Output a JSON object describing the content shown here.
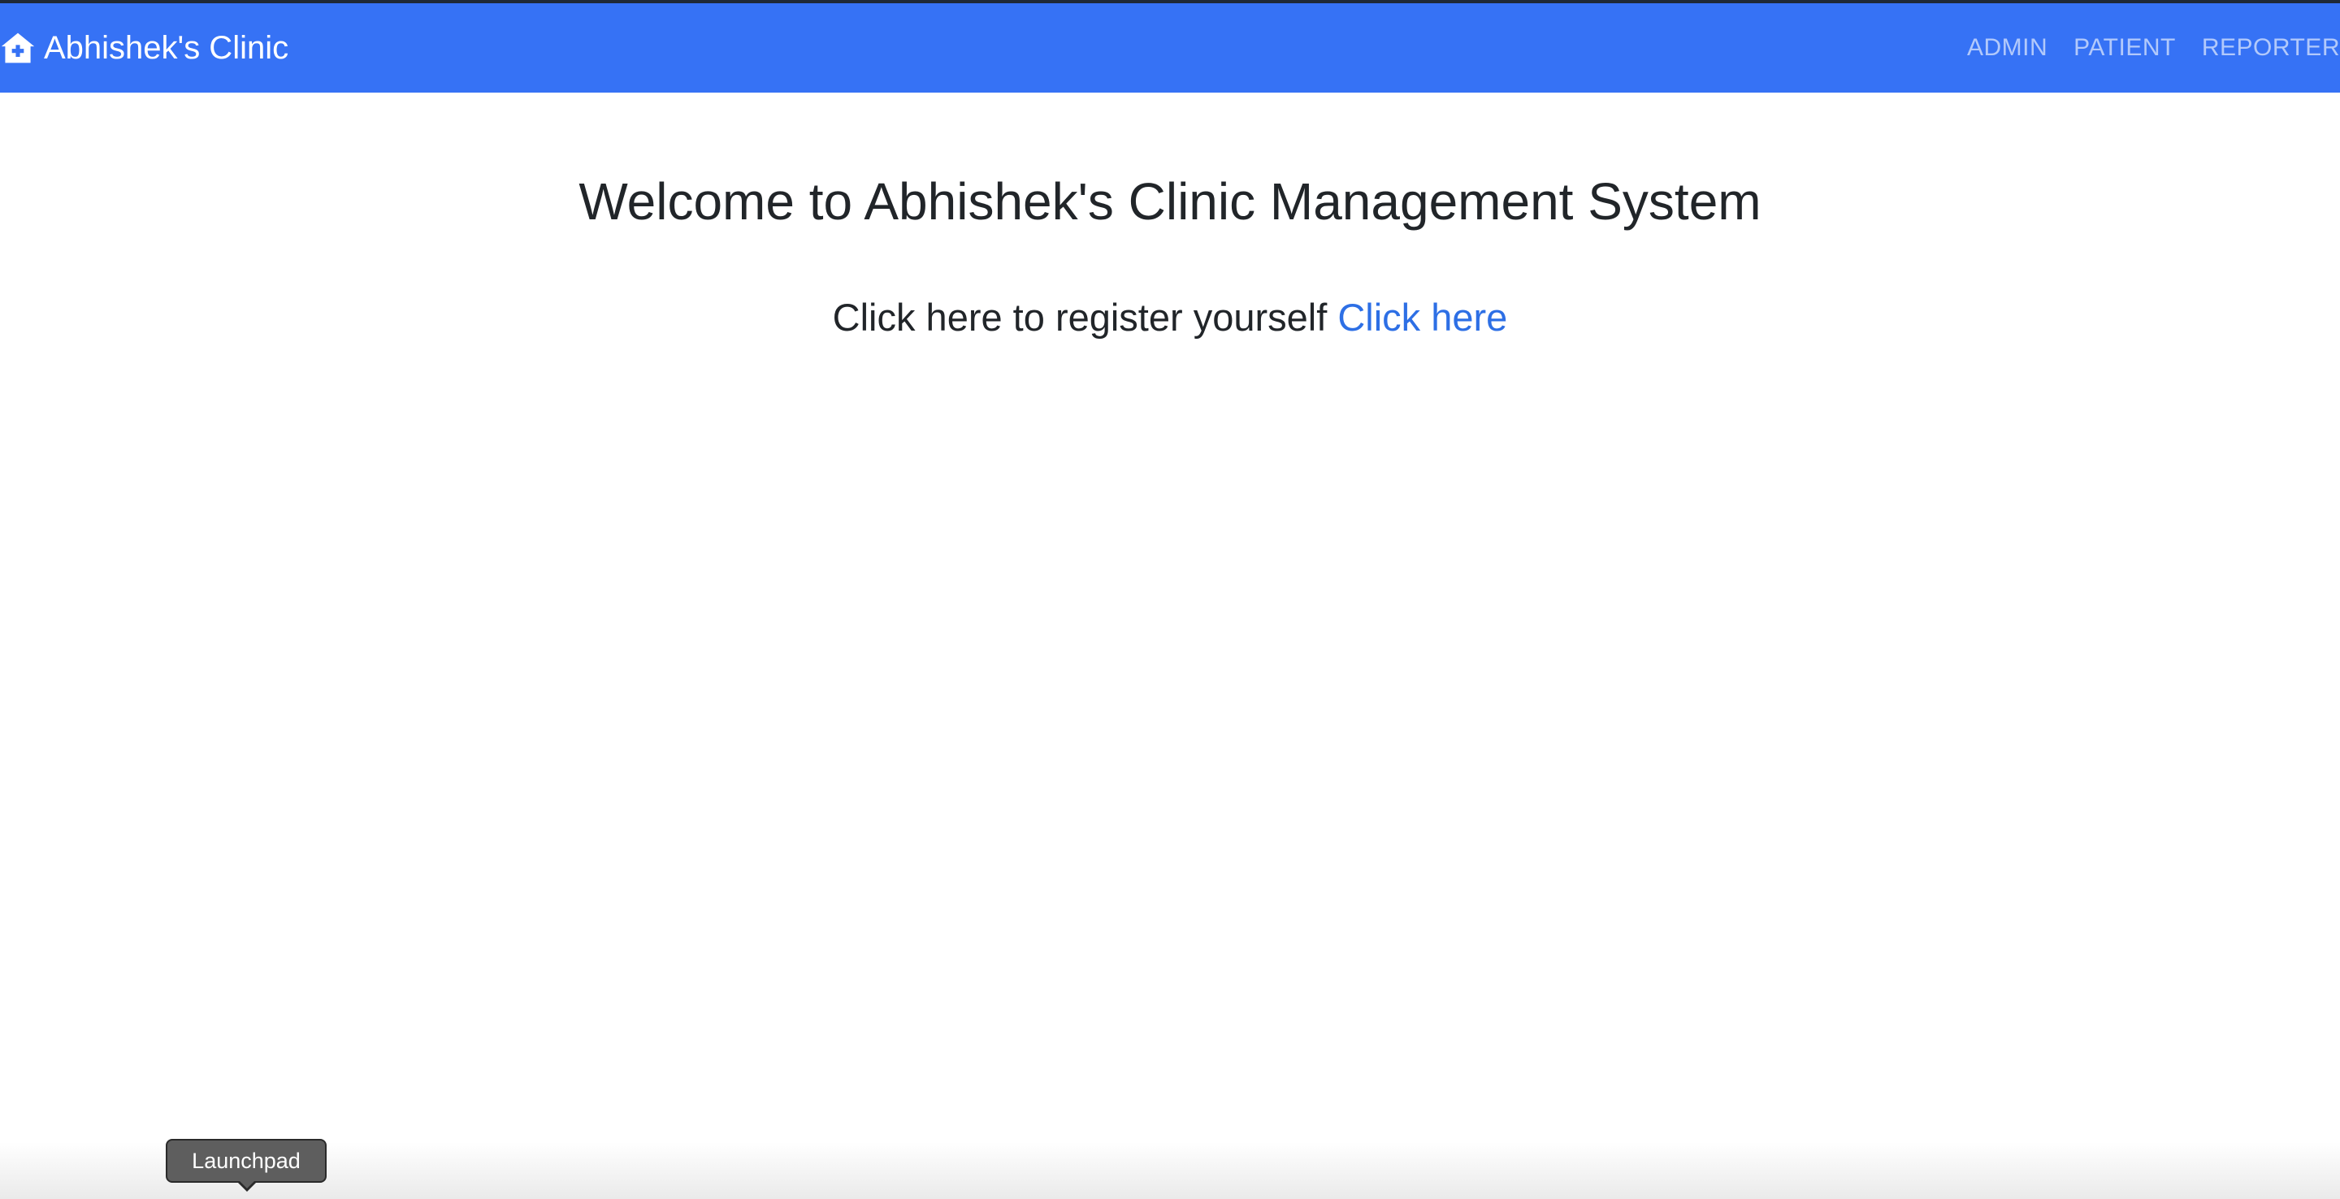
{
  "navbar": {
    "brand_label": "Abhishek's Clinic",
    "brand_icon": "clinic-home-plus-icon",
    "links": [
      {
        "label": "ADMIN"
      },
      {
        "label": "PATIENT"
      },
      {
        "label": "REPORTER"
      }
    ],
    "color": "#3672f5"
  },
  "main": {
    "title": "Welcome to Abhishek's Clinic Management System",
    "register_text": "Click here to register yourself",
    "register_link": "Click here",
    "link_color": "#2d6fe5"
  },
  "dock": {
    "tooltip": "Launchpad"
  }
}
